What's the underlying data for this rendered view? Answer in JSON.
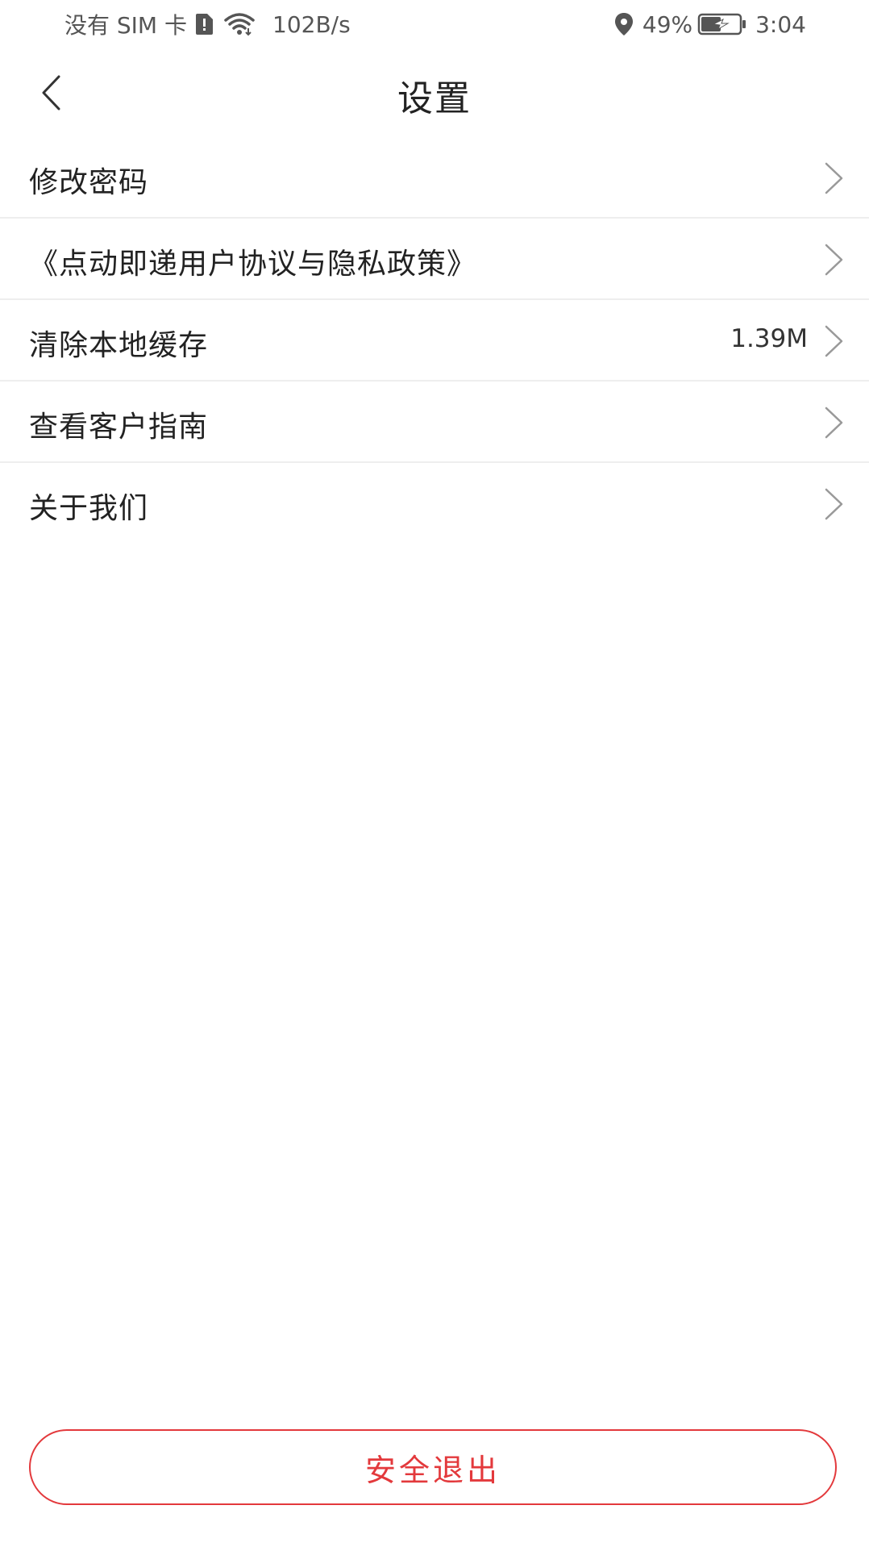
{
  "status_bar": {
    "carrier": "没有 SIM 卡",
    "net_speed": "102B/s",
    "battery_percent": "49%",
    "time": "3:04",
    "icons": [
      "sim-alert-icon",
      "wifi-icon",
      "location-icon",
      "battery-charging-icon"
    ]
  },
  "header": {
    "title": "设置",
    "back_icon": "back-arrow-icon"
  },
  "settings": {
    "items": [
      {
        "label": "修改密码",
        "value": ""
      },
      {
        "label": "《点动即递用户协议与隐私政策》",
        "value": ""
      },
      {
        "label": "清除本地缓存",
        "value": "1.39M"
      },
      {
        "label": "查看客户指南",
        "value": ""
      },
      {
        "label": "关于我们",
        "value": ""
      }
    ]
  },
  "footer": {
    "logout_label": "安全退出"
  },
  "colors": {
    "accent": "#e3393c",
    "divider": "#eeeeee",
    "text": "#222222",
    "chevron": "#999999"
  }
}
